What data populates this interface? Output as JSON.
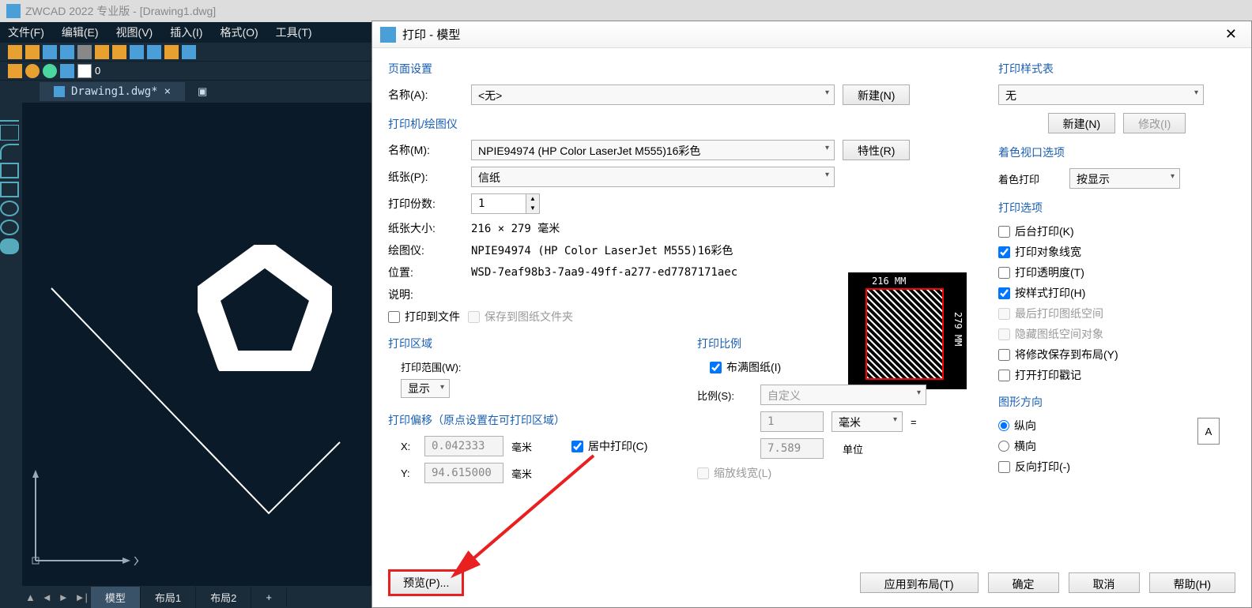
{
  "cad": {
    "title": "ZWCAD 2022 专业版 - [Drawing1.dwg]",
    "menus": [
      "文件(F)",
      "编辑(E)",
      "视图(V)",
      "插入(I)",
      "格式(O)",
      "工具(T)"
    ],
    "tab": "Drawing1.dwg*",
    "bottom_tabs": [
      "模型",
      "布局1",
      "布局2"
    ],
    "bottom_add": "+"
  },
  "dialog": {
    "title": "打印 - 模型",
    "page_setup": {
      "title": "页面设置",
      "name_label": "名称(A):",
      "name_value": "<无>",
      "new_btn": "新建(N)"
    },
    "printer": {
      "title": "打印机/绘图仪",
      "name_label": "名称(M):",
      "name_value": "NPIE94974 (HP Color LaserJet M555)16彩色",
      "props_btn": "特性(R)",
      "paper_label": "纸张(P):",
      "paper_value": "信纸",
      "copies_label": "打印份数:",
      "copies_value": "1",
      "size_label": "纸张大小:",
      "size_value": "216 × 279  毫米",
      "plotter_label": "绘图仪:",
      "plotter_value": "NPIE94974 (HP Color LaserJet M555)16彩色",
      "location_label": "位置:",
      "location_value": "WSD-7eaf98b3-7aa9-49ff-a277-ed7787171aec",
      "desc_label": "说明:",
      "to_file": "打印到文件",
      "save_folder": "保存到图纸文件夹",
      "preview_top": "216 MM",
      "preview_right": "279 MM"
    },
    "area": {
      "title": "打印区域",
      "range_label": "打印范围(W):",
      "range_value": "显示"
    },
    "offset": {
      "title": "打印偏移（原点设置在可打印区域）",
      "x_label": "X:",
      "x_value": "0.042333",
      "y_label": "Y:",
      "y_value": "94.615000",
      "unit": "毫米",
      "center": "居中打印(C)"
    },
    "scale": {
      "title": "打印比例",
      "fit": "布满图纸(I)",
      "scale_label": "比例(S):",
      "scale_value": "自定义",
      "num": "1",
      "num_unit": "毫米",
      "eq": "=",
      "denom": "7.589",
      "denom_unit": "单位",
      "scale_lw": "缩放线宽(L)"
    },
    "style": {
      "title": "打印样式表",
      "value": "无",
      "new_btn": "新建(N)",
      "modify_btn": "修改(I)"
    },
    "viewport": {
      "title": "着色视口选项",
      "shade_label": "着色打印",
      "shade_value": "按显示"
    },
    "options": {
      "title": "打印选项",
      "bg": "后台打印(K)",
      "lw": "打印对象线宽",
      "trans": "打印透明度(T)",
      "style": "按样式打印(H)",
      "last": "最后打印图纸空间",
      "hide": "隐藏图纸空间对象",
      "save_layout": "将修改保存到布局(Y)",
      "stamp": "打开打印戳记"
    },
    "orient": {
      "title": "图形方向",
      "portrait": "纵向",
      "landscape": "横向",
      "reverse": "反向打印(-)",
      "icon": "A"
    },
    "footer": {
      "preview": "预览(P)...",
      "apply": "应用到布局(T)",
      "ok": "确定",
      "cancel": "取消",
      "help": "帮助(H)"
    }
  }
}
